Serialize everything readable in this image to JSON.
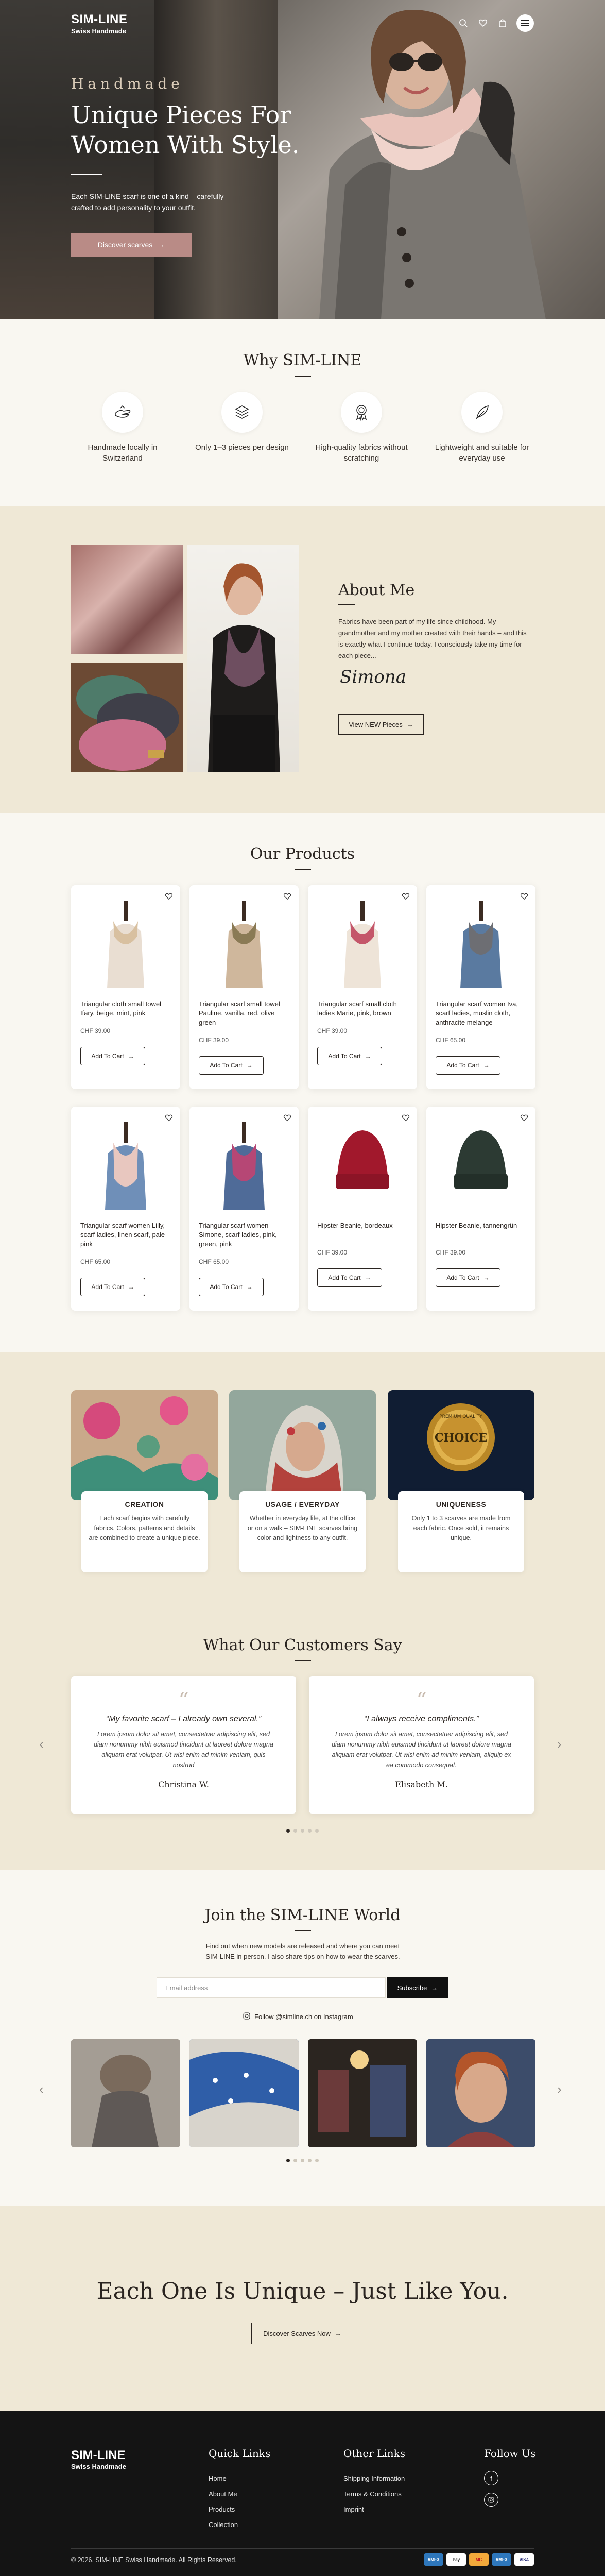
{
  "brand": {
    "line1": "SIM-LINE",
    "line2": "Swiss Handmade"
  },
  "nav": {
    "icons": [
      "search-icon",
      "heart-icon",
      "bag-icon",
      "menu-icon"
    ]
  },
  "hero": {
    "kicker": "Handmade",
    "title": "Unique Pieces For Women With Style.",
    "text": "Each SIM-LINE scarf is one of a kind – carefully crafted to add personality to your outfit.",
    "button": "Discover scarves"
  },
  "why": {
    "title": "Why SIM-LINE",
    "features": [
      {
        "icon": "fabric-hand-icon",
        "text": "Handmade locally in Switzerland"
      },
      {
        "icon": "stack-icon",
        "text": "Only 1–3 pieces per design"
      },
      {
        "icon": "award-icon",
        "text": "High-quality fabrics without scratching"
      },
      {
        "icon": "feather-icon",
        "text": "Lightweight and suitable for everyday use"
      }
    ]
  },
  "about": {
    "title": "About Me",
    "text": "Fabrics have been part of my life since childhood. My grandmother and my mother created with their hands – and this is exactly what I continue today. I consciously take my time for each piece...",
    "signature": "Simona",
    "button": "View NEW Pieces"
  },
  "products": {
    "title": "Our Products",
    "cart_label": "Add To Cart",
    "items": [
      {
        "name": "Triangular cloth small towel Ifary, beige, mint, pink",
        "price": "CHF 39.00"
      },
      {
        "name": "Triangular scarf small towel Pauline, vanilla, red, olive green",
        "price": "CHF 39.00"
      },
      {
        "name": "Triangular scarf small cloth ladies Marie, pink, brown",
        "price": "CHF 39.00"
      },
      {
        "name": "Triangular scarf women Iva, scarf ladies, muslin cloth, anthracite melange",
        "price": "CHF 65.00"
      },
      {
        "name": "Triangular scarf women Lilly, scarf ladies, linen scarf, pale pink",
        "price": "CHF 65.00"
      },
      {
        "name": "Triangular scarf women Simone, scarf ladies, pink, green, pink",
        "price": "CHF 65.00"
      },
      {
        "name": "Hipster Beanie, bordeaux",
        "price": "CHF 39.00"
      },
      {
        "name": "Hipster Beanie, tannengrün",
        "price": "CHF 39.00"
      }
    ]
  },
  "info": [
    {
      "title": "CREATION",
      "text": "Each scarf begins with carefully fabrics. Colors, patterns and details are combined to create a unique piece."
    },
    {
      "title": "USAGE / EVERYDAY",
      "text": "Whether in everyday life, at the office or on a walk – SIM-LINE scarves bring color and lightness to any outfit."
    },
    {
      "title": "UNIQUENESS",
      "text": "Only 1 to 3 scarves are made from each fabric. Once sold, it remains unique."
    }
  ],
  "choice_badge": {
    "top": "PREMIUM QUALITY",
    "main": "CHOICE"
  },
  "testimonials": {
    "title": "What Our Customers Say",
    "items": [
      {
        "quote": "“My favorite scarf – I already own several.”",
        "body": "Lorem ipsum dolor sit amet, consectetuer adipiscing elit, sed diam nonummy nibh euismod tincidunt ut laoreet dolore magna aliquam erat volutpat. Ut wisi enim ad minim veniam, quis nostrud",
        "name": "Christina W."
      },
      {
        "quote": "“I always receive compliments.”",
        "body": "Lorem ipsum dolor sit amet, consectetuer adipiscing elit, sed diam nonummy nibh euismod tincidunt ut laoreet dolore magna aliquam erat volutpat. Ut wisi enim ad minim veniam, aliquip ex ea commodo consequat.",
        "name": "Elisabeth M."
      }
    ]
  },
  "join": {
    "title": "Join the SIM-LINE World",
    "text": "Find out when new models are released and where you can meet SIM-LINE in person. I also share tips on how to wear the scarves.",
    "email_placeholder": "Email address",
    "subscribe": "Subscribe",
    "instagram": "Follow @simline.ch on Instagram"
  },
  "cta": {
    "title": "Each One Is Unique – Just Like You.",
    "button": "Discover Scarves Now"
  },
  "footer": {
    "quick_title": "Quick Links",
    "quick": [
      "Home",
      "About Me",
      "Products",
      "Collection"
    ],
    "other_title": "Other Links",
    "other": [
      "Shipping Information",
      "Terms & Conditions",
      "Imprint"
    ],
    "follow_title": "Follow Us",
    "copyright": "© 2026, SIM-LINE Swiss Handmade. All Rights Reserved.",
    "payments": [
      "AMEX",
      "Pay",
      "MC",
      "AMEX",
      "VISA"
    ]
  }
}
